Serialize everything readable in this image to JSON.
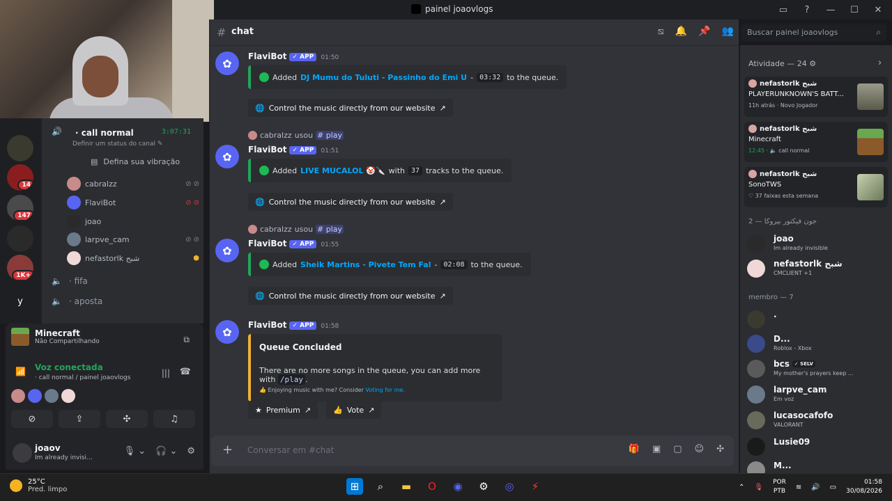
{
  "window": {
    "title": "painel joaovlogs"
  },
  "channel_header": {
    "name": "chat",
    "search_placeholder": "Buscar painel joaovlogs"
  },
  "server_badges": [
    "14",
    "147",
    "1K+"
  ],
  "server_letter": "y",
  "voice_channel": {
    "name": "call normal",
    "timer": "3:07:31",
    "status_prompt": "Definir um status do canal",
    "vibe_button": "Defina sua vibração",
    "users": [
      "cabralzz",
      "FlaviBot",
      "joao",
      "larpve_cam",
      "nefastorlk شبح"
    ],
    "other_channels": [
      "fifa",
      "aposta"
    ]
  },
  "activity_panel": {
    "game": "Minecraft",
    "sharing": "Não Compartilhando",
    "voice_connected": "Voz conectada",
    "voice_location": "call normal / painel joaovlogs"
  },
  "user_panel": {
    "name": "joaov",
    "status": "Im already invisi..."
  },
  "messages": [
    {
      "author": "FlaviBot",
      "tag": "APP",
      "time": "01:50",
      "added": "Added",
      "track": "DJ Mumu do Tuluti - Passinho do Emi U",
      "sep": "-",
      "duration": "03:32",
      "suffix": "to the queue.",
      "button": "Control the music directly from our website"
    },
    {
      "reply_user": "cabralzz",
      "reply_verb": "usou",
      "reply_cmd": "play",
      "author": "FlaviBot",
      "tag": "APP",
      "time": "01:51",
      "added": "Added",
      "track": "LIVE MUCALOL 🤡🔪",
      "with": "with",
      "count": "37",
      "suffix": "tracks to the queue.",
      "button": "Control the music directly from our website"
    },
    {
      "reply_user": "cabralzz",
      "reply_verb": "usou",
      "reply_cmd": "play",
      "author": "FlaviBot",
      "tag": "APP",
      "time": "01:55",
      "added": "Added",
      "track": "Sheik Martins - Pivete Tem Fal",
      "sep": "-",
      "duration": "02:08",
      "suffix": "to the queue.",
      "button": "Control the music directly from our website"
    },
    {
      "author": "FlaviBot",
      "tag": "APP",
      "time": "01:58",
      "embed_title": "Queue Concluded",
      "embed_desc": "There are no more songs in the queue, you can add more with",
      "embed_cmd": "/play",
      "embed_footer": "Enjoying music with me? Consider",
      "embed_link": "Voting for me.",
      "btn_premium": "Premium",
      "btn_vote": "Vote"
    }
  ],
  "composer": {
    "placeholder": "Conversar em #chat"
  },
  "right_panel": {
    "activity_header": "Atividade — 24",
    "cards": [
      {
        "user": "nefastorlk شبح",
        "game": "PLAYERUNKNOWN'S BATT...",
        "meta_a": "11h atrás",
        "meta_b": "Novo Jogador"
      },
      {
        "user": "nefastorlk شبح",
        "game": "Minecraft",
        "meta_a": "12:45",
        "meta_b": "call normal"
      },
      {
        "user": "nefastorlk شبح",
        "game": "SonoTWS",
        "meta_a": "37 faixas esta semana",
        "meta_b": ""
      }
    ],
    "role1_header": "جون فيكتور بيروكا — 2",
    "role1_members": [
      {
        "name": "joao",
        "status": "Im already invisible"
      },
      {
        "name": "nefastorlk شبح",
        "status": "CMCLIENT +1"
      }
    ],
    "role2_header": "membro — 7",
    "role2_members": [
      {
        "name": ".",
        "status": ""
      },
      {
        "name": "D...",
        "status": "Roblox - Xbox"
      },
      {
        "name": "bcs",
        "badge": "SELV",
        "status": "My mother's prayers keep ..."
      },
      {
        "name": "larpve_cam",
        "status": "Em voz"
      },
      {
        "name": "lucasocafofo",
        "status": "VALORANT"
      },
      {
        "name": "Lusie09",
        "status": ""
      },
      {
        "name": "M...",
        "status": ""
      }
    ]
  },
  "taskbar": {
    "temp": "25°C",
    "weather": "Pred. limpo",
    "lang1": "POR",
    "lang2": "PTB",
    "time": "01:58",
    "date": "30/08/2026"
  }
}
